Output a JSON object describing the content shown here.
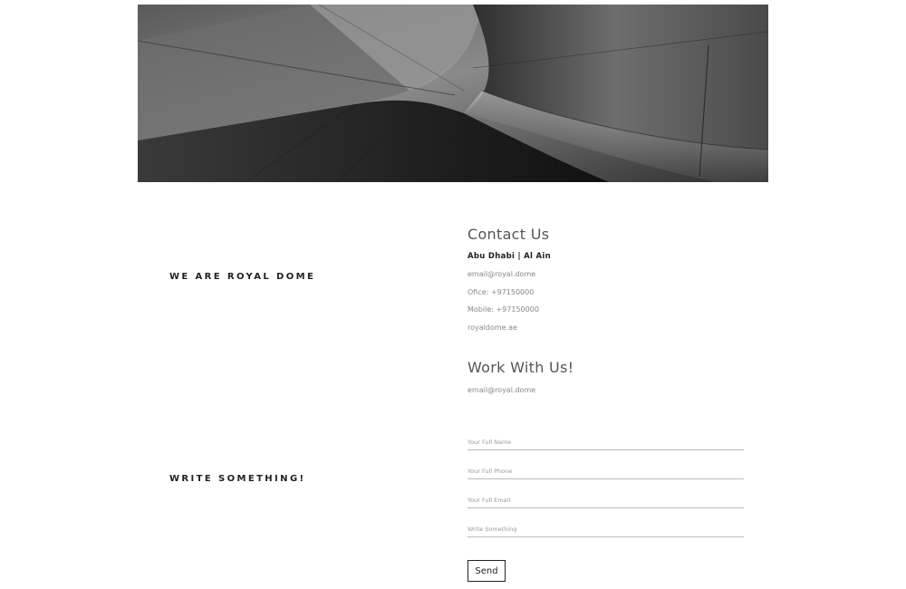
{
  "about": {
    "heading": "WE ARE ROYAL DOME"
  },
  "contact": {
    "title": "Contact Us",
    "location": "Abu Dhabi | Al Ain",
    "email": "email@royal.dome",
    "office": "Ofice: +97150000",
    "mobile": "Mobile: +97150000",
    "website": "royaldome.ae"
  },
  "work": {
    "title": "Work With Us!",
    "email": "email@royal.dome"
  },
  "form": {
    "heading": "WRITE SOMETHING!",
    "name_placeholder": "Your Full Name",
    "phone_placeholder": "Your Full Phone",
    "email_placeholder": "Your Full Email",
    "message_placeholder": "Write Something",
    "send_label": "Send"
  }
}
